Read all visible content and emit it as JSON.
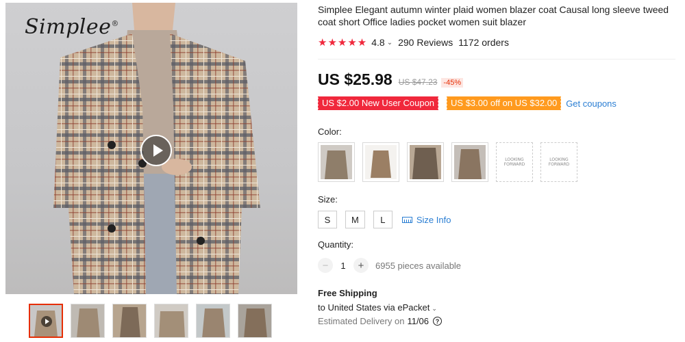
{
  "product": {
    "brand_logo": "Simplee",
    "title": "Simplee Elegant autumn winter plaid women blazer coat Causal long sleeve tweed coat short Office ladies pocket women suit blazer",
    "rating": "4.8",
    "reviews": "290 Reviews",
    "orders": "1172 orders"
  },
  "pricing": {
    "price": "US $25.98",
    "original_price": "US $47.23",
    "discount": "-45%"
  },
  "coupons": {
    "new_user": "US $2.00 New User Coupon",
    "store": "US $3.00 off on US $32.00",
    "get_coupons": "Get coupons"
  },
  "color": {
    "label": "Color:",
    "placeholder_text": "LOOKING FORWARD"
  },
  "size": {
    "label": "Size:",
    "options": [
      "S",
      "M",
      "L"
    ],
    "info_link": "Size Info"
  },
  "quantity": {
    "label": "Quantity:",
    "value": "1",
    "minus": "−",
    "plus": "+",
    "available": "6955 pieces available"
  },
  "shipping": {
    "title": "Free Shipping",
    "to": "to United States via ePacket",
    "delivery_label": "Estimated Delivery on",
    "delivery_date": "11/06"
  },
  "colors": {
    "accent_red": "#f0283c",
    "coupon_orange": "#ff9a1e",
    "link_blue": "#2a7ed3"
  }
}
